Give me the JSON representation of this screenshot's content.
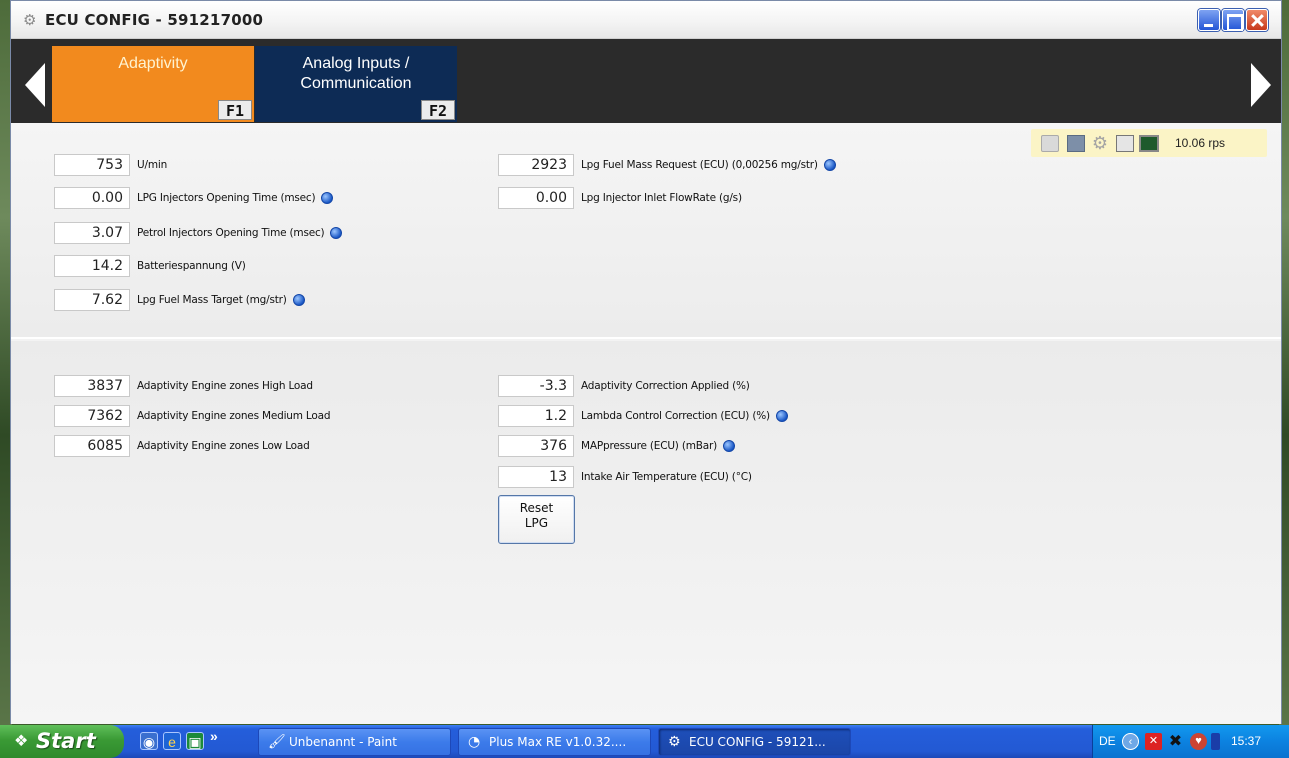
{
  "window": {
    "title": "ECU CONFIG - 591217000"
  },
  "tabs": [
    {
      "label": "Adaptivity",
      "fkey": "F1",
      "active": true
    },
    {
      "label": "Analog Inputs /\nCommunication",
      "fkey": "F2",
      "active": false
    }
  ],
  "toolbar": {
    "rate": "10.06 rps",
    "icons": [
      "open-folder-icon",
      "save-icon",
      "gear-icon",
      "document-icon",
      "monitor-icon"
    ]
  },
  "top_left": [
    {
      "value": "753",
      "label": "U/min",
      "info": false
    },
    {
      "value": "0.00",
      "label": "LPG Injectors Opening Time (msec)",
      "info": true
    },
    {
      "value": "3.07",
      "label": "Petrol Injectors Opening Time (msec)",
      "info": true
    },
    {
      "value": "14.2",
      "label": "Batteriespannung (V)",
      "info": false
    },
    {
      "value": "7.62",
      "label": "Lpg Fuel Mass Target (mg/str)",
      "info": true
    }
  ],
  "top_right": [
    {
      "value": "2923",
      "label": "Lpg Fuel Mass Request (ECU) (0,00256 mg/str)",
      "info": true
    },
    {
      "value": "0.00",
      "label": "Lpg Injector Inlet FlowRate (g/s)",
      "info": false
    }
  ],
  "bottom_left": [
    {
      "value": "3837",
      "label": "Adaptivity Engine zones High Load",
      "info": false
    },
    {
      "value": "7362",
      "label": "Adaptivity Engine zones Medium Load",
      "info": false
    },
    {
      "value": "6085",
      "label": "Adaptivity Engine zones Low Load",
      "info": false
    }
  ],
  "bottom_right": [
    {
      "value": "-3.3",
      "label": "Adaptivity Correction Applied (%)",
      "info": false
    },
    {
      "value": "1.2",
      "label": "Lambda Control Correction (ECU) (%)",
      "info": true
    },
    {
      "value": "376",
      "label": "MAPpressure (ECU) (mBar)",
      "info": true
    },
    {
      "value": "13",
      "label": "Intake Air Temperature (ECU) (°C)",
      "info": false
    }
  ],
  "reset_button": "Reset\nLPG",
  "taskbar": {
    "start": "Start",
    "tasks": [
      "Unbenannt - Paint",
      "Plus Max RE v1.0.32....",
      "ECU CONFIG - 59121..."
    ],
    "lang": "DE",
    "clock": "15:37"
  },
  "colors": {
    "tab_active": "#f28a1e",
    "tab_inactive": "#0d2b55",
    "tabbar_bg": "#2b2b2b",
    "toolbar_bg": "#fbf4c6"
  }
}
